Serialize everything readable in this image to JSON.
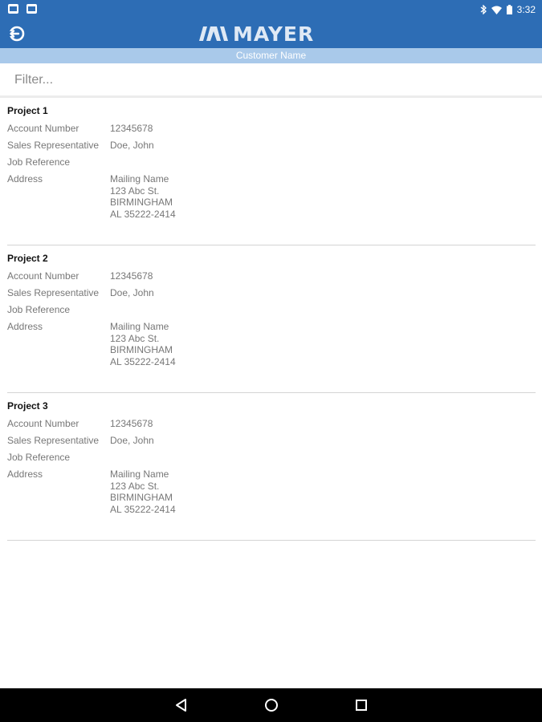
{
  "status_bar": {
    "time": "3:32"
  },
  "app_bar": {
    "logo_text": "MAYER"
  },
  "subheader": {
    "customer_name": "Customer Name"
  },
  "filter": {
    "placeholder": "Filter..."
  },
  "labels": {
    "account_number": "Account Number",
    "sales_rep": "Sales Representative",
    "job_reference": "Job Reference",
    "address": "Address"
  },
  "projects": [
    {
      "title": "Project 1",
      "account_number": "12345678",
      "sales_rep": "Doe, John",
      "job_reference": "",
      "address": [
        "Mailing Name",
        "123 Abc St.",
        "BIRMINGHAM",
        "AL 35222-2414"
      ]
    },
    {
      "title": "Project 2",
      "account_number": "12345678",
      "sales_rep": "Doe, John",
      "job_reference": "",
      "address": [
        "Mailing Name",
        "123 Abc St.",
        "BIRMINGHAM",
        "AL 35222-2414"
      ]
    },
    {
      "title": "Project 3",
      "account_number": "12345678",
      "sales_rep": "Doe, John",
      "job_reference": "",
      "address": [
        "Mailing Name",
        "123 Abc St.",
        "BIRMINGHAM",
        "AL 35222-2414"
      ]
    }
  ],
  "colors": {
    "primary": "#2d6db5",
    "subheader": "#a9c9ea"
  }
}
